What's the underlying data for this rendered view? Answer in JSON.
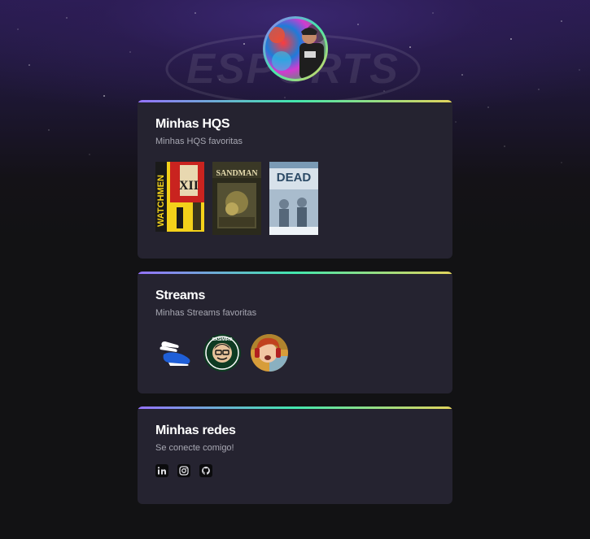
{
  "profile": {
    "avatar": "avatar-photo"
  },
  "background": {
    "watermark": "ESPORTS"
  },
  "sections": {
    "comics": {
      "title": "Minhas HQS",
      "subtitle": "Minhas HQS favoritas",
      "items": [
        {
          "name": "watchmen",
          "cover_text": "WATCHMEN",
          "issue": "XII"
        },
        {
          "name": "sandman",
          "cover_text": "SANDMAN"
        },
        {
          "name": "the-walking-dead",
          "cover_text": "DEAD"
        }
      ]
    },
    "streams": {
      "title": "Streams",
      "subtitle": "Minhas Streams favoritas",
      "items": [
        {
          "name": "winged-shoe-logo"
        },
        {
          "name": "casimiro-logo",
          "ring_text": "CASIMIRO"
        },
        {
          "name": "streamer-avatar"
        }
      ]
    },
    "social": {
      "title": "Minhas redes",
      "subtitle": "Se conecte comigo!",
      "icons": [
        "linkedin-icon",
        "instagram-icon",
        "github-icon"
      ]
    }
  },
  "colors": {
    "gradient": [
      "#9572fc",
      "#43e7ad",
      "#e2d45c"
    ],
    "card_bg": "#252330",
    "page_bg": "#121214",
    "text_primary": "#ffffff",
    "text_secondary": "#a8a8b3"
  }
}
